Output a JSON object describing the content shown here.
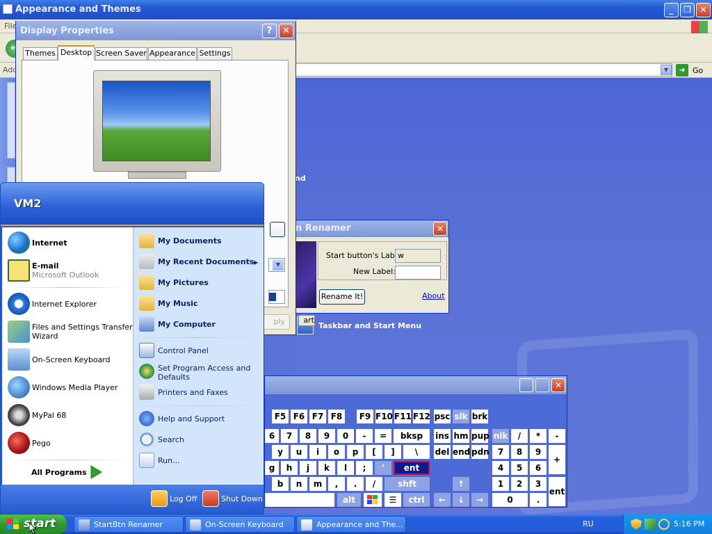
{
  "appearance_window": {
    "title": "Appearance and Themes",
    "menu_partial": "File",
    "address_label_partial": "Add",
    "go_label": "Go",
    "task_text_partial": "nd",
    "taskbar_link": "Taskbar and Start Menu"
  },
  "display_properties": {
    "title": "Display Properties",
    "tabs": [
      "Themes",
      "Desktop",
      "Screen Saver",
      "Appearance",
      "Settings"
    ],
    "active_tab": "Desktop",
    "apply_partial": "ply"
  },
  "renamer": {
    "title_partial": "n Renamer",
    "start_label": "Start button's Label:",
    "start_value": "w",
    "new_label": "New Label:",
    "new_value": "",
    "rename_button": "Rename It!",
    "about_link": "About",
    "art_button_partial": "art"
  },
  "start_menu": {
    "user": "VM2",
    "left": {
      "internet": {
        "title": "Internet"
      },
      "email": {
        "title": "E-mail",
        "subtitle": "Microsoft Outlook"
      },
      "ie": "Internet Explorer",
      "fast_line1": "Files and Settings Transfer",
      "fast_line2": "Wizard",
      "osk": "On-Screen Keyboard",
      "wmp": "Windows Media Player",
      "mypal": "MyPal 68",
      "pego": "Pego"
    },
    "all_programs": "All Programs",
    "right": {
      "documents": "My Documents",
      "recent": "My Recent Documents",
      "pictures": "My Pictures",
      "music": "My Music",
      "computer": "My Computer",
      "control_panel": "Control Panel",
      "spad_line1": "Set Program Access and",
      "spad_line2": "Defaults",
      "printers": "Printers and Faxes",
      "help": "Help and Support",
      "search": "Search",
      "run": "Run..."
    },
    "log_off": "Log Off",
    "shut_down": "Shut Down"
  },
  "keyboard": {
    "fkeys1": [
      "F5",
      "F6",
      "F7",
      "F8"
    ],
    "fkeys2": [
      "F9",
      "F10",
      "F11",
      "F12"
    ],
    "special1": [
      "psc",
      "slk",
      "brk"
    ],
    "row_num": [
      "6",
      "7",
      "8",
      "9",
      "0",
      "-",
      "=",
      "bksp"
    ],
    "nav1": [
      "ins",
      "hm",
      "pup"
    ],
    "nav2": [
      "del",
      "end",
      "pdn"
    ],
    "row_q": [
      "y",
      "u",
      "i",
      "o",
      "p",
      "[",
      "]",
      "\\"
    ],
    "row_a": [
      "g",
      "h",
      "j",
      "k",
      "l",
      ";",
      "'"
    ],
    "ent": "ent",
    "row_z": [
      "b",
      "n",
      "m",
      ",",
      ".",
      "/"
    ],
    "shift": "shft",
    "alt": "alt",
    "ctrl": "ctrl",
    "arrows": [
      "↑",
      "←",
      "↓",
      "→"
    ],
    "numpad_top": [
      "nlk",
      "/",
      "*",
      "-"
    ],
    "numpad_r1": [
      "7",
      "8",
      "9"
    ],
    "numpad_plus": "+",
    "numpad_r2": [
      "4",
      "5",
      "6"
    ],
    "numpad_r3": [
      "1",
      "2",
      "3"
    ],
    "numpad_ent": "ent",
    "numpad_r4": [
      "0",
      "."
    ]
  },
  "taskbar": {
    "start": "start",
    "tasks": [
      "StartBtn Renamer",
      "On-Screen Keyboard",
      "Appearance and The..."
    ],
    "language": "RU",
    "clock": "5:16 PM"
  },
  "colors": {
    "xp_blue": "#245edb",
    "start_green": "#2f9a2f",
    "ent_key": "#0b1a8c"
  }
}
